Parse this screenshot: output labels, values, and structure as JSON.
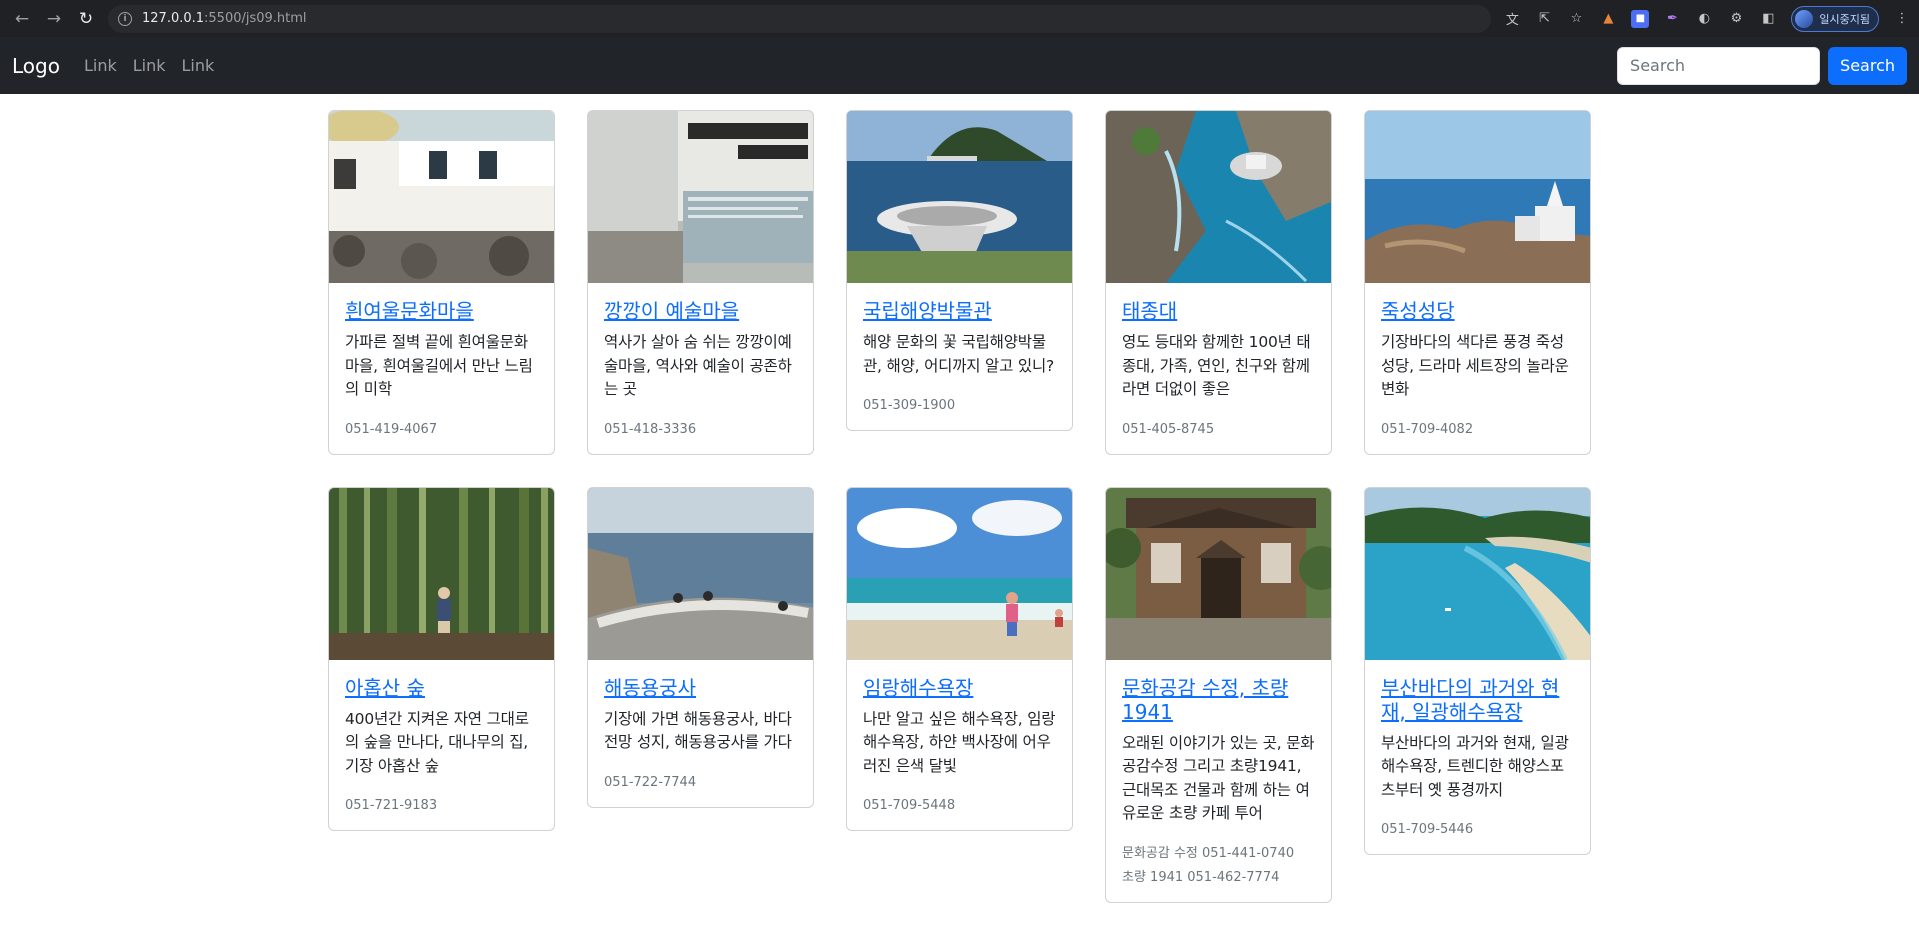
{
  "browser": {
    "url_host": "127.0.0.1",
    "url_path": ":5500/js09.html",
    "profile_label": "일시중지됨"
  },
  "navbar": {
    "brand": "Logo",
    "links": [
      "Link",
      "Link",
      "Link"
    ],
    "search_placeholder": "Search",
    "search_button": "Search"
  },
  "cards": [
    {
      "title": "흰여울문화마을",
      "text": "가파른 절벽 끝에 흰여울문화마을, 흰여울길에서 만난 느림의 미학",
      "phone": "051-419-4067"
    },
    {
      "title": "깡깡이 예술마을",
      "text": "역사가 살아 숨 쉬는 깡깡이예술마을, 역사와 예술이 공존하는 곳",
      "phone": "051-418-3336"
    },
    {
      "title": "국립해양박물관",
      "text": "해양 문화의 꽃 국립해양박물관, 해양, 어디까지 알고 있니?",
      "phone": "051-309-1900"
    },
    {
      "title": "태종대",
      "text": "영도 등대와 함께한 100년 태종대, 가족, 연인, 친구와 함께라면 더없이 좋은",
      "phone": "051-405-8745"
    },
    {
      "title": "죽성성당",
      "text": "기장바다의 색다른 풍경 죽성성당, 드라마 세트장의 놀라운 변화",
      "phone": "051-709-4082"
    },
    {
      "title": "아홉산 숲",
      "text": "400년간 지켜온 자연 그대로의 숲을 만나다, 대나무의 집, 기장 아홉산 숲",
      "phone": "051-721-9183"
    },
    {
      "title": "해동용궁사",
      "text": "기장에 가면 해동용궁사, 바다전망 성지, 해동용궁사를 가다",
      "phone": "051-722-7744"
    },
    {
      "title": "임랑해수욕장",
      "text": "나만 알고 싶은 해수욕장, 임랑해수욕장, 하얀 백사장에 어우러진 은색 달빛",
      "phone": "051-709-5448"
    },
    {
      "title": "문화공감 수정, 초량1941",
      "text": "오래된 이야기가 있는 곳, 문화공감수정 그리고 초량1941, 근대목조 건물과 함께 하는 여유로운 초량 카페 투어",
      "phone": "문화공감 수정 051-441-0740\n초량 1941 051-462-7774"
    },
    {
      "title": "부산바다의 과거와 현재, 일광해수욕장",
      "text": "부산바다의 과거와 현재, 일광해수욕장, 트렌디한 해양스포츠부터 옛 풍경까지",
      "phone": "051-709-5446"
    }
  ]
}
